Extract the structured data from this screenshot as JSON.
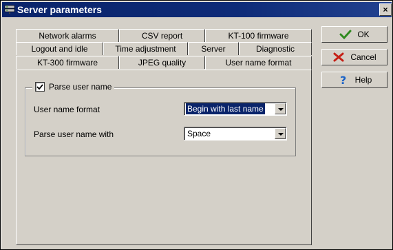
{
  "window": {
    "title": "Server parameters"
  },
  "tabs": {
    "row1": [
      "Network alarms",
      "CSV report",
      "KT-100 firmware"
    ],
    "row2": [
      "Logout and idle",
      "Time adjustment",
      "Server",
      "Diagnostic"
    ],
    "row3": [
      "KT-300 firmware",
      "JPEG quality",
      "User name format"
    ]
  },
  "group": {
    "title": "Parse user name",
    "checked": true
  },
  "fields": {
    "format_label": "User name format",
    "format_value": "Begin with last name",
    "parse_label": "Parse user name with",
    "parse_value": "Space"
  },
  "buttons": {
    "ok": "OK",
    "cancel": "Cancel",
    "help": "Help"
  },
  "icons": {
    "ok": "check-icon",
    "cancel": "x-icon",
    "help": "question-icon"
  },
  "colors": {
    "title_bg": "#0a246a",
    "accent": "#0a246a",
    "ok_icon": "#2f8a1f",
    "cancel_icon": "#c51f15",
    "help_icon": "#1a62c7"
  }
}
